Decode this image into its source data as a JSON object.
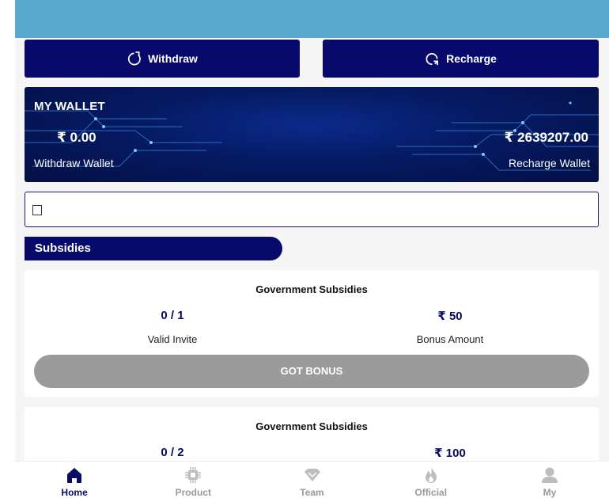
{
  "actions": {
    "withdraw_label": "Withdraw",
    "recharge_label": "Recharge"
  },
  "wallet": {
    "title": "MY WALLET",
    "withdraw_amount": "₹ 0.00",
    "withdraw_label": "Withdraw Wallet",
    "recharge_amount": "₹ 2639207.00",
    "recharge_label": "Recharge Wallet"
  },
  "section": {
    "title": "Subsidies"
  },
  "cards": [
    {
      "title": "Government Subsidies",
      "invite_value": "0 / 1",
      "invite_label": "Valid Invite",
      "bonus_value": "₹ 50",
      "bonus_label": "Bonus Amount",
      "button_label": "GOT BONUS"
    },
    {
      "title": "Government Subsidies",
      "invite_value": "0 / 2",
      "bonus_value": "₹ 100"
    }
  ],
  "nav": [
    {
      "label": "Home",
      "icon": "home-icon",
      "active": true
    },
    {
      "label": "Product",
      "icon": "chip-icon"
    },
    {
      "label": "Team",
      "icon": "diamond-icon"
    },
    {
      "label": "Official",
      "icon": "fire-icon"
    },
    {
      "label": "My",
      "icon": "user-icon"
    }
  ],
  "colors": {
    "primary": "#070a6b",
    "banner": "#57a9cd",
    "disabled": "#9b9b9b",
    "inactive_nav": "#999999"
  }
}
